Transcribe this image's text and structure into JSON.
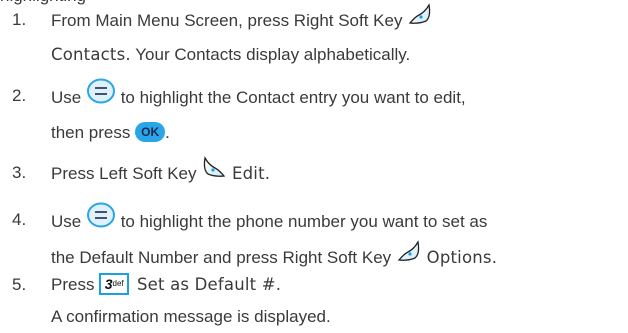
{
  "header_fragment": "highlighting",
  "icons": {
    "right_soft_key": "right-soft-key-icon",
    "left_soft_key": "left-soft-key-icon",
    "navigation_key": "navigation-key-icon",
    "ok_key": "ok-key-icon",
    "key_3": "key-3-def-icon"
  },
  "colors": {
    "key_accent": "#2aa6e8",
    "text": "#3a3a3a"
  },
  "ok_key_label": "OK",
  "key3": {
    "digit": "3",
    "letters": "def"
  },
  "steps": [
    {
      "number": "1.",
      "line1": "From Main Menu Screen, press Right Soft Key",
      "lcd_word": "Contacts.",
      "line2_rest": "Your Contacts display alphabetically."
    },
    {
      "number": "2.",
      "use": "Use",
      "line1_rest": "to highlight the Contact entry you want to edit,",
      "line2": "then press"
    },
    {
      "number": "3.",
      "line1": "Press Left Soft Key",
      "lcd_word": "Edit."
    },
    {
      "number": "4.",
      "use": "Use",
      "line1_rest": "to highlight the phone number you want to set as",
      "line2": "the Default Number and press Right Soft Key",
      "lcd_word": "Options."
    },
    {
      "number": "5.",
      "press": "Press",
      "lcd_word": "Set as Default #.",
      "line2": "A confirmation message is displayed."
    }
  ]
}
